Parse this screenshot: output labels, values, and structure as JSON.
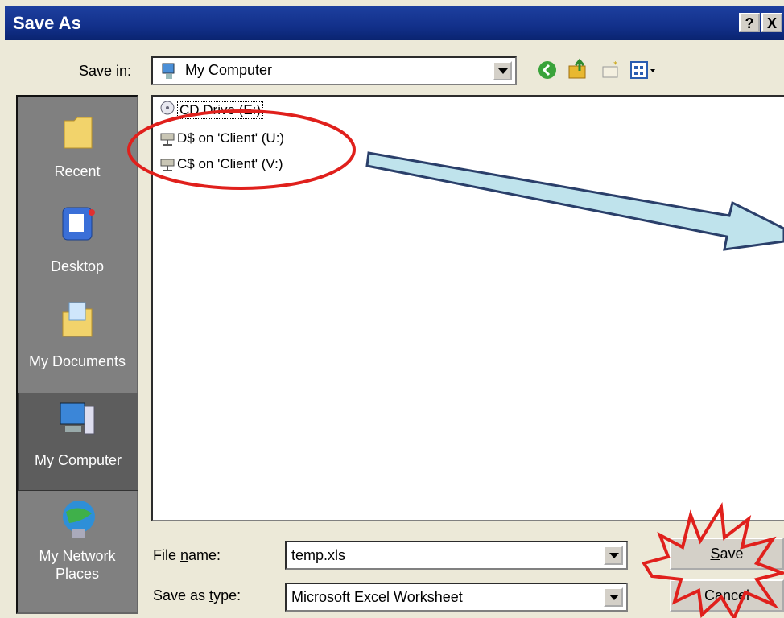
{
  "window": {
    "title": "Save As"
  },
  "title_buttons": {
    "help": "?",
    "close": "X"
  },
  "save_in": {
    "label": "Save in:",
    "value": "My Computer"
  },
  "toolbar": {
    "icons": [
      "back-icon",
      "up-folder-icon",
      "new-folder-icon",
      "views-menu-icon"
    ]
  },
  "places": [
    {
      "label": "Recent",
      "icon": "recent-folder-icon"
    },
    {
      "label": "Desktop",
      "icon": "desktop-icon"
    },
    {
      "label": "My Documents",
      "icon": "my-documents-icon"
    },
    {
      "label": "My Computer",
      "icon": "my-computer-icon"
    },
    {
      "label": "My Network Places",
      "icon": "network-places-icon"
    }
  ],
  "files": [
    {
      "label": "CD Drive (E:)",
      "icon": "cd-drive-icon"
    },
    {
      "label": "D$ on 'Client' (U:)",
      "icon": "network-drive-icon"
    },
    {
      "label": "C$ on 'Client' (V:)",
      "icon": "network-drive-icon"
    }
  ],
  "filename": {
    "label": "File name:",
    "value": "temp.xls"
  },
  "filetype": {
    "label": "Save as type:",
    "value": "Microsoft Excel Worksheet"
  },
  "buttons": {
    "save": "Save",
    "cancel": "Cancel"
  },
  "annotations": {
    "highlight_color": "#e0201c",
    "arrow_fill": "#bfe3ec",
    "arrow_stroke": "#2a3f6a"
  }
}
